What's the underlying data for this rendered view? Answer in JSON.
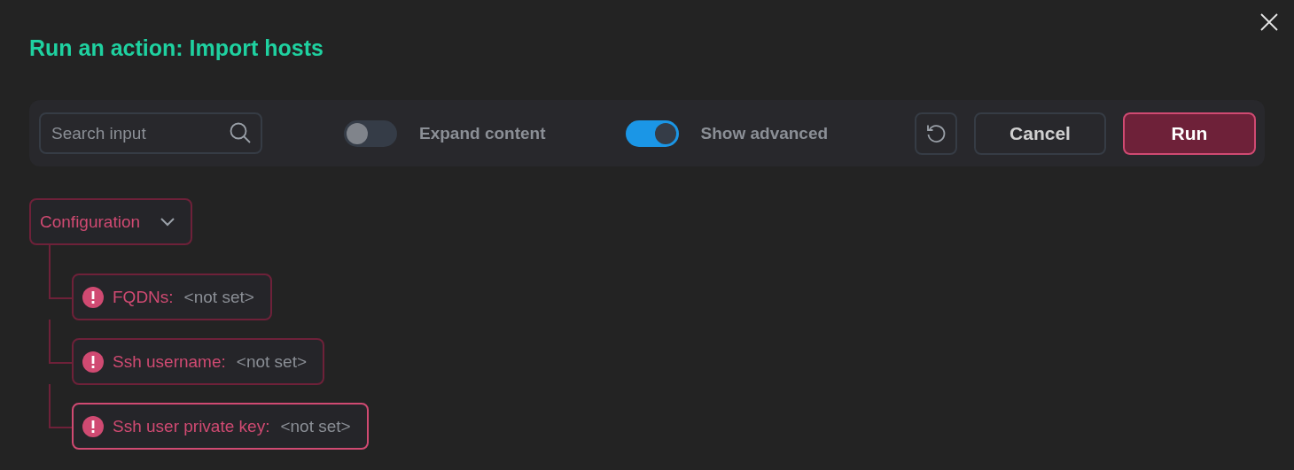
{
  "dialog": {
    "title": "Run an action: Import hosts"
  },
  "toolbar": {
    "search": {
      "placeholder": "Search input"
    },
    "toggles": [
      {
        "label": "Expand content",
        "on": false
      },
      {
        "label": "Show advanced",
        "on": true
      }
    ],
    "buttons": [
      {
        "kind": "reset"
      },
      {
        "kind": "secondary",
        "label": "Cancel"
      },
      {
        "kind": "primary",
        "label": "Run"
      }
    ]
  },
  "tree": {
    "label": "Configuration",
    "expanded": true,
    "children": [
      {
        "label": "FQDNs:",
        "value": "<not set>",
        "error": true,
        "selected": false
      },
      {
        "label": "Ssh username:",
        "value": "<not set>",
        "error": true,
        "selected": false
      },
      {
        "label": "Ssh user private key:",
        "value": "<not set>",
        "error": true,
        "selected": true
      }
    ]
  }
}
